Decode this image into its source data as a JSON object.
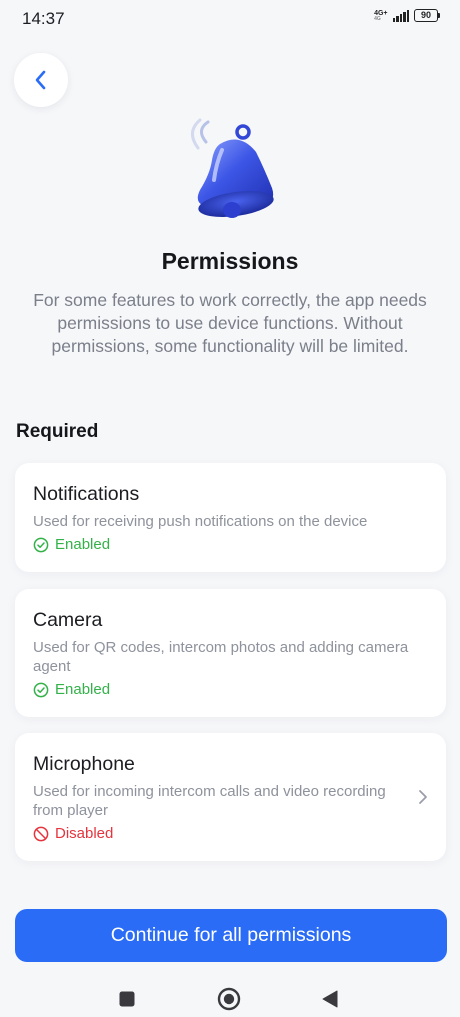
{
  "status_bar": {
    "time": "14:37",
    "network": "4G+",
    "network_sub": "4G",
    "battery": "90"
  },
  "colors": {
    "accent": "#2a6cf6",
    "enabled": "#34b24a",
    "disabled": "#e5343d",
    "background": "#f6f7f9"
  },
  "header": {
    "back_icon": "chevron-left-icon",
    "illustration": "bell-icon"
  },
  "page": {
    "title": "Permissions",
    "description": "For some features to work correctly, the app needs permissions to use device functions. Without permissions, some functionality will be limited."
  },
  "section": {
    "heading": "Required"
  },
  "permissions": [
    {
      "title": "Notifications",
      "description": "Used for receiving push notifications on the device",
      "status": "Enabled",
      "status_icon": "check-circle-icon"
    },
    {
      "title": "Camera",
      "description": "Used for QR codes, intercom photos and adding camera agent",
      "status": "Enabled",
      "status_icon": "check-circle-icon"
    },
    {
      "title": "Microphone",
      "description": "Used for incoming intercom calls and video recording from player",
      "status": "Disabled",
      "status_icon": "block-icon",
      "action_icon": "chevron-right-icon"
    }
  ],
  "footer": {
    "continue_label": "Continue for all permissions"
  },
  "nav_bar": {
    "recents_icon": "square-icon",
    "home_icon": "circle-icon",
    "back_icon": "triangle-back-icon"
  }
}
